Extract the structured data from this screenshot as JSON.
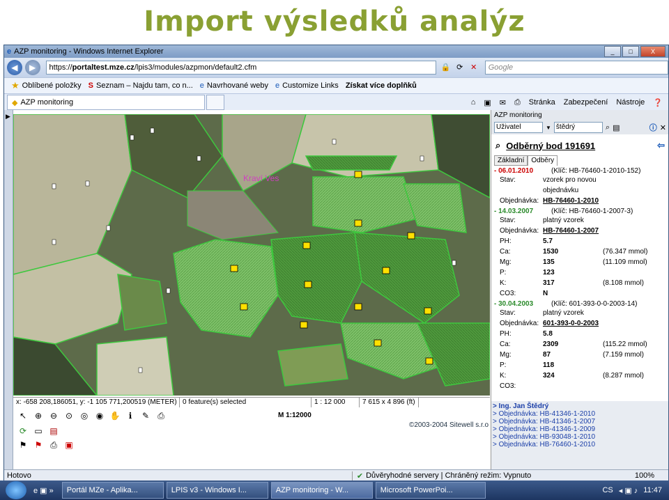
{
  "slide_title": "Import výsledků analýz",
  "window": {
    "title": "AZP monitoring - Windows Internet Explorer",
    "controls": [
      "_",
      "□",
      "X"
    ]
  },
  "address": {
    "protocol": "https://",
    "host": "portaltest.mze.cz",
    "path": "/lpis3/modules/azpmon/default2.cfm",
    "search_placeholder": "Google"
  },
  "favorites": {
    "items": [
      "Oblíbené položky",
      "Seznam – Najdu tam, co n...",
      "Navrhované weby",
      "Customize Links",
      "Získat více doplňků"
    ]
  },
  "tabbar": {
    "tab_title": "AZP monitoring",
    "commands": [
      "Stránka",
      "Zabezpečení",
      "Nástroje"
    ]
  },
  "map": {
    "village_label": "Kraví Ves",
    "coords": "x: -658 208,186051, y: -1 105 771,200519 (METER)",
    "features": "0 feature(s) selected",
    "scale_box": "1 : 12 000",
    "size": "7 615 x 4 896 (ft)",
    "scale_label": "M 1:12000",
    "copyright": "©2003-2004 Sitewell s.r.o"
  },
  "right_panel": {
    "header": "AZP monitoring",
    "user_select": "Uživatel",
    "user_input": "štědrý",
    "bod_title": "Odběrný bod 191691",
    "tabs": [
      "Základní",
      "Odběry"
    ],
    "records": [
      {
        "date": "- 06.01.2010",
        "status": "red",
        "key": "(Klíč: HB-76460-1-2010-152)",
        "rows": [
          {
            "k": "Stav:",
            "v": "vzorek pro novou objednávku",
            "m": ""
          },
          {
            "k": "Objednávka:",
            "v": "HB-76460-1-2010",
            "m": "",
            "link": true
          }
        ]
      },
      {
        "date": "- 14.03.2007",
        "status": "green",
        "key": "(Klíč: HB-76460-1-2007-3)",
        "rows": [
          {
            "k": "Stav:",
            "v": "platný vzorek",
            "m": ""
          },
          {
            "k": "Objednávka:",
            "v": "HB-76460-1-2007",
            "m": "",
            "link": true
          },
          {
            "k": "PH:",
            "v": "5.7",
            "m": ""
          },
          {
            "k": "Ca:",
            "v": "1530",
            "m": "(76.347 mmol)"
          },
          {
            "k": "Mg:",
            "v": "135",
            "m": "(11.109 mmol)"
          },
          {
            "k": "P:",
            "v": "123",
            "m": ""
          },
          {
            "k": "K:",
            "v": "317",
            "m": "(8.108 mmol)"
          },
          {
            "k": "CO3:",
            "v": "N",
            "m": ""
          }
        ]
      },
      {
        "date": "- 30.04.2003",
        "status": "green",
        "key": "(Klíč: 601-393-0-0-2003-14)",
        "rows": [
          {
            "k": "Stav:",
            "v": "platný vzorek",
            "m": ""
          },
          {
            "k": "Objednávka:",
            "v": "601-393-0-0-2003",
            "m": "",
            "link": true
          },
          {
            "k": "PH:",
            "v": "5.8",
            "m": ""
          },
          {
            "k": "Ca:",
            "v": "2309",
            "m": "(115.22 mmol)"
          },
          {
            "k": "Mg:",
            "v": "87",
            "m": "(7.159 mmol)"
          },
          {
            "k": "P:",
            "v": "118",
            "m": ""
          },
          {
            "k": "K:",
            "v": "324",
            "m": "(8.287 mmol)"
          },
          {
            "k": "CO3:",
            "v": "",
            "m": ""
          }
        ]
      }
    ],
    "links": {
      "name": "> Ing. Jan Štědrý",
      "orders": [
        "> Objednávka: HB-41346-1-2010",
        "> Objednávka: HB-41346-1-2007",
        "> Objednávka: HB-41346-1-2009",
        "> Objednávka: HB-93048-1-2010",
        "> Objednávka: HB-76460-1-2010"
      ]
    }
  },
  "statusbar": {
    "left": "Hotovo",
    "security": "Důvěryhodné servery | Chráněný režim: Vypnuto",
    "zoom": "100%"
  },
  "taskbar": {
    "items": [
      "Portál MZe - Aplika...",
      "LPIS v3 - Windows I...",
      "AZP monitoring - W...",
      "Microsoft PowerPoi..."
    ],
    "lang": "CS",
    "time": "11:47"
  }
}
